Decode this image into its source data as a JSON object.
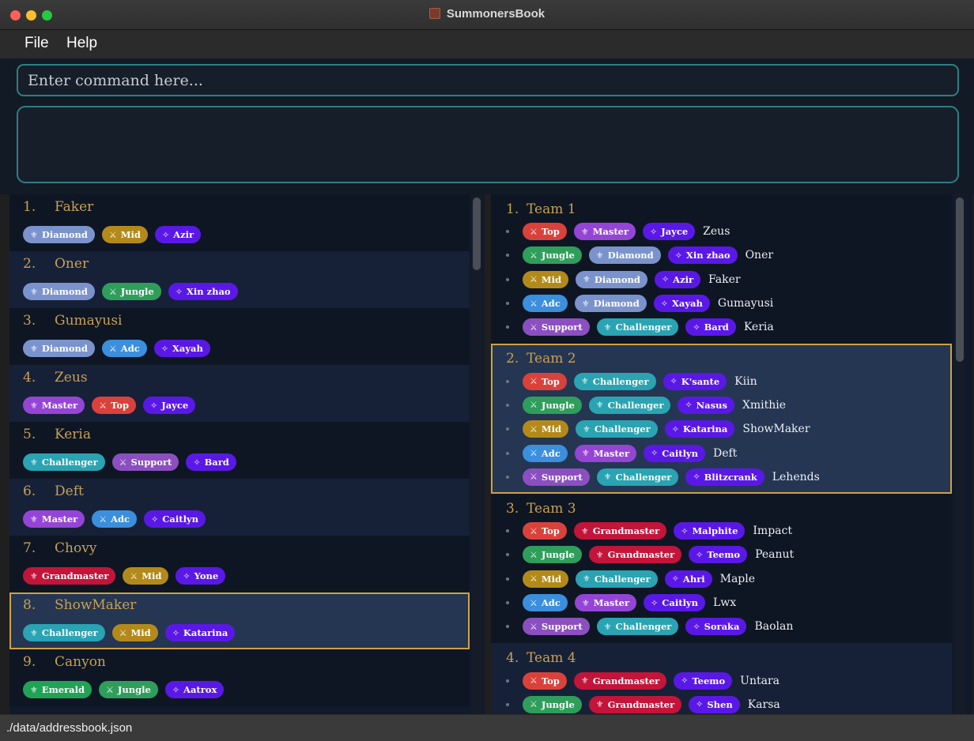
{
  "window": {
    "title": "SummonersBook"
  },
  "menu": {
    "file": "File",
    "help": "Help"
  },
  "command": {
    "placeholder": "Enter command here...",
    "value": ""
  },
  "colors": {
    "Diamond": "#7b93cc",
    "Master": "#9545d6",
    "Challenger": "#2aa3b2",
    "Grandmaster": "#c3143a",
    "Emerald": "#20a354",
    "Top": "#d9423b",
    "Jungle": "#2f9e5b",
    "Mid": "#b38a1a",
    "Adc": "#3b8fdc",
    "Support": "#8b4fc0",
    "Champion": "#5a18e6",
    "accent": "#c9a24a"
  },
  "glyphs": {
    "rank": "⚜",
    "role": "⚔",
    "champion": "✧"
  },
  "persons": [
    {
      "index": "1.",
      "name": "Faker",
      "tags": [
        {
          "type": "rank",
          "label": "Diamond"
        },
        {
          "type": "role",
          "label": "Mid"
        },
        {
          "type": "champ",
          "label": "Azir"
        }
      ]
    },
    {
      "index": "2.",
      "name": "Oner",
      "tags": [
        {
          "type": "rank",
          "label": "Diamond"
        },
        {
          "type": "role",
          "label": "Jungle"
        },
        {
          "type": "champ",
          "label": "Xin zhao"
        }
      ]
    },
    {
      "index": "3.",
      "name": "Gumayusi",
      "tags": [
        {
          "type": "rank",
          "label": "Diamond"
        },
        {
          "type": "role",
          "label": "Adc"
        },
        {
          "type": "champ",
          "label": "Xayah"
        }
      ]
    },
    {
      "index": "4.",
      "name": "Zeus",
      "tags": [
        {
          "type": "rank",
          "label": "Master"
        },
        {
          "type": "role",
          "label": "Top"
        },
        {
          "type": "champ",
          "label": "Jayce"
        }
      ]
    },
    {
      "index": "5.",
      "name": "Keria",
      "tags": [
        {
          "type": "rank",
          "label": "Challenger"
        },
        {
          "type": "role",
          "label": "Support"
        },
        {
          "type": "champ",
          "label": "Bard"
        }
      ]
    },
    {
      "index": "6.",
      "name": "Deft",
      "tags": [
        {
          "type": "rank",
          "label": "Master"
        },
        {
          "type": "role",
          "label": "Adc"
        },
        {
          "type": "champ",
          "label": "Caitlyn"
        }
      ]
    },
    {
      "index": "7.",
      "name": "Chovy",
      "tags": [
        {
          "type": "rank",
          "label": "Grandmaster"
        },
        {
          "type": "role",
          "label": "Mid"
        },
        {
          "type": "champ",
          "label": "Yone"
        }
      ]
    },
    {
      "index": "8.",
      "name": "ShowMaker",
      "selected": true,
      "tags": [
        {
          "type": "rank",
          "label": "Challenger"
        },
        {
          "type": "role",
          "label": "Mid"
        },
        {
          "type": "champ",
          "label": "Katarina"
        }
      ]
    },
    {
      "index": "9.",
      "name": "Canyon",
      "tags": [
        {
          "type": "rank",
          "label": "Emerald"
        },
        {
          "type": "role",
          "label": "Jungle"
        },
        {
          "type": "champ",
          "label": "Aatrox"
        }
      ]
    }
  ],
  "teams": [
    {
      "index": "1.",
      "name": "Team 1",
      "members": [
        {
          "role": "Top",
          "rank": "Master",
          "champ": "Jayce",
          "name": "Zeus"
        },
        {
          "role": "Jungle",
          "rank": "Diamond",
          "champ": "Xin zhao",
          "name": "Oner"
        },
        {
          "role": "Mid",
          "rank": "Diamond",
          "champ": "Azir",
          "name": "Faker"
        },
        {
          "role": "Adc",
          "rank": "Diamond",
          "champ": "Xayah",
          "name": "Gumayusi"
        },
        {
          "role": "Support",
          "rank": "Challenger",
          "champ": "Bard",
          "name": "Keria"
        }
      ]
    },
    {
      "index": "2.",
      "name": "Team 2",
      "selected": true,
      "members": [
        {
          "role": "Top",
          "rank": "Challenger",
          "champ": "K'sante",
          "name": "Kiin"
        },
        {
          "role": "Jungle",
          "rank": "Challenger",
          "champ": "Nasus",
          "name": "Xmithie"
        },
        {
          "role": "Mid",
          "rank": "Challenger",
          "champ": "Katarina",
          "name": "ShowMaker"
        },
        {
          "role": "Adc",
          "rank": "Master",
          "champ": "Caitlyn",
          "name": "Deft"
        },
        {
          "role": "Support",
          "rank": "Challenger",
          "champ": "Blitzcrank",
          "name": "Lehends"
        }
      ]
    },
    {
      "index": "3.",
      "name": "Team 3",
      "members": [
        {
          "role": "Top",
          "rank": "Grandmaster",
          "champ": "Malphite",
          "name": "Impact"
        },
        {
          "role": "Jungle",
          "rank": "Grandmaster",
          "champ": "Teemo",
          "name": "Peanut"
        },
        {
          "role": "Mid",
          "rank": "Challenger",
          "champ": "Ahri",
          "name": "Maple"
        },
        {
          "role": "Adc",
          "rank": "Master",
          "champ": "Caitlyn",
          "name": "Lwx"
        },
        {
          "role": "Support",
          "rank": "Challenger",
          "champ": "Soraka",
          "name": "Baolan"
        }
      ]
    },
    {
      "index": "4.",
      "name": "Team 4",
      "members": [
        {
          "role": "Top",
          "rank": "Grandmaster",
          "champ": "Teemo",
          "name": "Untara"
        },
        {
          "role": "Jungle",
          "rank": "Grandmaster",
          "champ": "Shen",
          "name": "Karsa"
        }
      ]
    }
  ],
  "status": {
    "path": "./data/addressbook.json"
  }
}
